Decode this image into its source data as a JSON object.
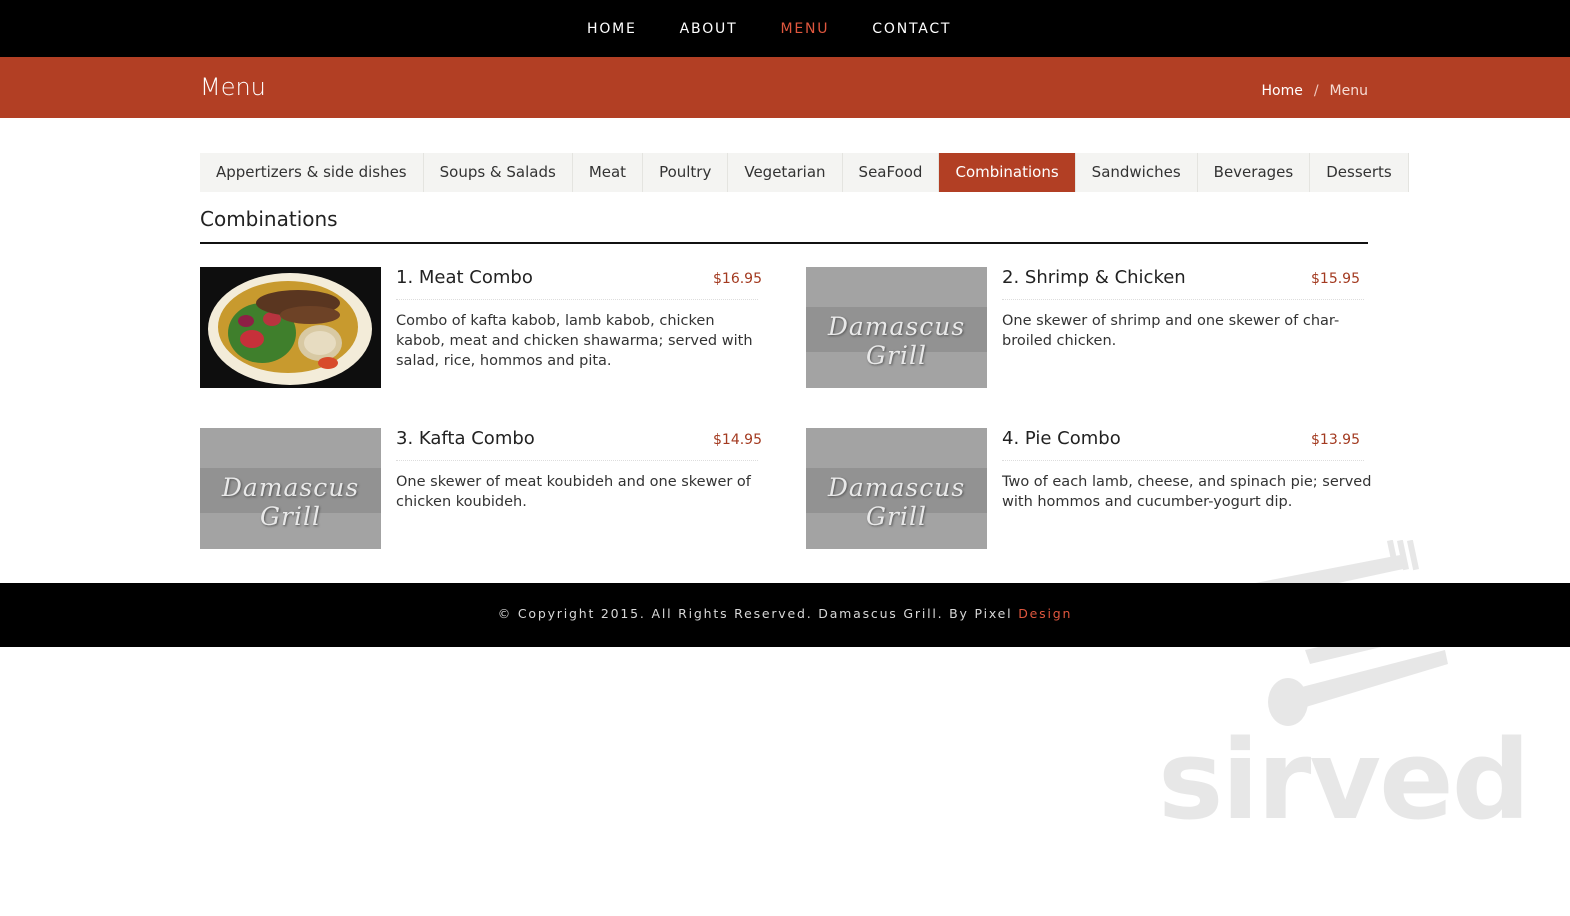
{
  "nav": {
    "items": [
      "HOME",
      "ABOUT",
      "MENU",
      "CONTACT"
    ],
    "active": "MENU"
  },
  "banner": {
    "title": "Menu",
    "breadcrumb": {
      "home": "Home",
      "separator": "/",
      "current": "Menu"
    }
  },
  "tabs": [
    "Appertizers & side dishes",
    "Soups & Salads",
    "Meat",
    "Poultry",
    "Vegetarian",
    "SeaFood",
    "Combinations",
    "Sandwiches",
    "Beverages",
    "Desserts"
  ],
  "active_tab": "Combinations",
  "section": {
    "title": "Combinations"
  },
  "items": [
    {
      "name": "1. Meat Combo",
      "price": "$16.95",
      "description": "Combo of kafta kabob, lamb kabob, chicken kabob, meat and chicken shawarma; served with salad, rice, hommos and pita.",
      "image": "food-photo"
    },
    {
      "name": "2. Shrimp & Chicken",
      "price": "$15.95",
      "description": "One skewer of shrimp and one skewer of char-broiled chicken.",
      "image": "placeholder-logo"
    },
    {
      "name": "3. Kafta Combo",
      "price": "$14.95",
      "description": "One skewer of meat koubideh and one skewer of chicken koubideh.",
      "image": "placeholder-logo"
    },
    {
      "name": "4. Pie Combo",
      "price": "$13.95",
      "description": "Two of each lamb, cheese, and spinach pie; served with hommos and cucumber-yogurt dip.",
      "image": "placeholder-logo"
    }
  ],
  "placeholder_logo_text": "Damascus Grill",
  "footer": {
    "copyright": "© Copyright 2015. All Rights Reserved. Damascus Grill. By Pixel ",
    "accent": "Design"
  },
  "watermark": {
    "text": "sirved"
  },
  "colors": {
    "accent": "#b23f24",
    "nav_active": "#e0573e",
    "price": "#a33a20"
  }
}
